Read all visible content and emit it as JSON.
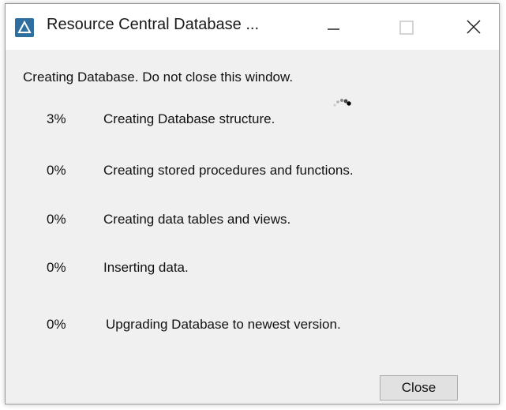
{
  "window": {
    "title": "Resource Central Database ..."
  },
  "status": {
    "message": "Creating Database. Do not close this window."
  },
  "steps": [
    {
      "percent": "3%",
      "label": "Creating Database structure."
    },
    {
      "percent": "0%",
      "label": "Creating stored procedures and functions."
    },
    {
      "percent": "0%",
      "label": "Creating data tables and views."
    },
    {
      "percent": "0%",
      "label": "Inserting data."
    },
    {
      "percent": "0%",
      "label": "Upgrading Database to newest version."
    }
  ],
  "footer": {
    "close_label": "Close"
  },
  "icons": {
    "app": "app-logo-icon",
    "minimize": "minimize-icon",
    "maximize": "maximize-icon",
    "close": "close-icon",
    "spinner": "loading-spinner-icon"
  },
  "colors": {
    "title_bar_bg": "#ffffff",
    "window_bg": "#f0f0f0",
    "app_icon_bg": "#2f6f9f",
    "button_bg": "#e1e1e1"
  }
}
